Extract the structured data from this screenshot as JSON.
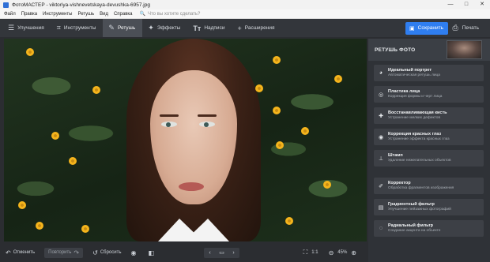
{
  "window": {
    "title": "ФотоМАСТЕР - viktoriya-vishnevetskaya-devushka-6957.jpg",
    "controls": [
      "—",
      "□",
      "✕"
    ]
  },
  "menu": {
    "items": [
      "Файл",
      "Правка",
      "Инструменты",
      "Ретушь",
      "Вид",
      "Справка"
    ],
    "search_placeholder": "Что вы хотите сделать?"
  },
  "toolbar": {
    "tabs": [
      {
        "label": "Улучшения",
        "icon": "sliders-icon"
      },
      {
        "label": "Инструменты",
        "icon": "crop-icon"
      },
      {
        "label": "Ретушь",
        "icon": "brush-icon",
        "active": true
      },
      {
        "label": "Эффекты",
        "icon": "magic-wand-icon"
      },
      {
        "label": "Надписи",
        "icon": "text-icon"
      },
      {
        "label": "Расширения",
        "icon": "plus-icon"
      }
    ],
    "save_label": "Сохранить",
    "print_label": "Печать"
  },
  "bottombar": {
    "undo_label": "Отменить",
    "redo_label": "Повторить",
    "reset_label": "Сбросить",
    "fit_label": "1:1",
    "zoom": "45%"
  },
  "panel": {
    "title": "РЕТУШЬ ФОТО",
    "tools": [
      {
        "name": "Идеальный портрет",
        "desc": "Автоматическая ретушь лица",
        "icon": "portrait-icon"
      },
      {
        "name": "Пластика лица",
        "desc": "Коррекция формы и черт лица",
        "icon": "face-shape-icon"
      },
      {
        "name": "Восстанавливающая кисть",
        "desc": "Устранение мелких дефектов",
        "icon": "healing-brush-icon"
      },
      {
        "name": "Коррекция красных глаз",
        "desc": "Устранение эффекта красных глаз",
        "icon": "eye-icon"
      },
      {
        "name": "Штамп",
        "desc": "Удаление нежелательных объектов",
        "icon": "stamp-icon"
      },
      {
        "name": "Корректор",
        "desc": "Обработка фрагментов изображения",
        "icon": "corrector-icon"
      },
      {
        "name": "Градиентный фильтр",
        "desc": "Улучшение пейзажных фотографий",
        "icon": "gradient-filter-icon"
      },
      {
        "name": "Радиальный фильтр",
        "desc": "Создание акцента на объекте",
        "icon": "radial-filter-icon"
      }
    ]
  },
  "colors": {
    "accent": "#2f7ef0",
    "background": "#2b2d31",
    "panel": "#2f3237",
    "tool_card": "#3d4046"
  }
}
